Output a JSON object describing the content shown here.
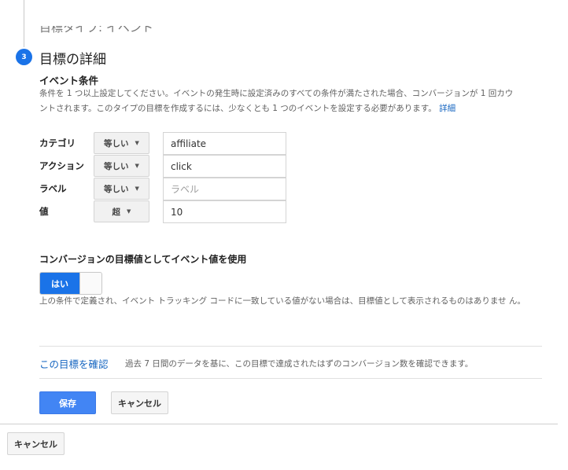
{
  "prev_step": {
    "label": "目標タイプ: イベント"
  },
  "step": {
    "number": "3",
    "title": "目標の詳細"
  },
  "event_conditions": {
    "heading": "イベント条件",
    "description_line1": "条件を 1 つ以上設定してください。イベントの発生時に設定済みのすべての条件が満たされた場合、コンバージョンが 1 回カウ",
    "description_line2": "ントされます。このタイプの目標を作成するには、少なくとも 1 つのイベントを設定する必要があります。",
    "details_link": "詳細",
    "rows": [
      {
        "label": "カテゴリ",
        "operator": "等しい",
        "value": "affiliate",
        "placeholder": ""
      },
      {
        "label": "アクション",
        "operator": "等しい",
        "value": "click",
        "placeholder": ""
      },
      {
        "label": "ラベル",
        "operator": "等しい",
        "value": "",
        "placeholder": "ラベル"
      },
      {
        "label": "値",
        "operator": "超",
        "value": "10",
        "placeholder": ""
      }
    ]
  },
  "use_event_value": {
    "heading": "コンバージョンの目標値としてイベント値を使用",
    "toggle_label": "はい",
    "toggle_state": "on",
    "note": "上の条件で定義され、イベント トラッキング コードに一致している値がない場合は、目標値として表示されるものはありませ ん。"
  },
  "verify": {
    "link": "この目標を確認",
    "description": "過去 7 日間のデータを基に、この目標で達成されたはずのコンバージョン数を確認できます。"
  },
  "buttons": {
    "save": "保存",
    "cancel": "キャンセル",
    "outer_cancel": "キャンセル"
  },
  "colors": {
    "accent": "#1a73e8",
    "save_button": "#4285f4",
    "link": "#1565c0"
  }
}
